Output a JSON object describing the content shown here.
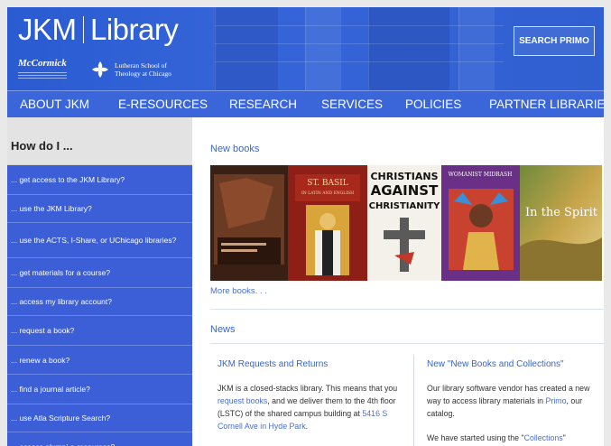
{
  "header": {
    "title_left": "JKM",
    "title_right": "Library",
    "logo_mccormick": "McCormick",
    "logo_lstc_line1": "Lutheran School of",
    "logo_lstc_line2": "Theology at Chicago",
    "search_button": "SEARCH PRIMO"
  },
  "nav": {
    "items": [
      "ABOUT JKM",
      "E-RESOURCES",
      "RESEARCH",
      "SERVICES",
      "POLICIES",
      "PARTNER LIBRARIES"
    ]
  },
  "sidebar": {
    "heading": "How do I ...",
    "items": [
      "... get access to the JKM Library?",
      "... use the JKM Library?",
      "... use the ACTS, I-Share, or UChicago libraries?",
      "... get materials for a course?",
      "... access my library account?",
      "... request a book?",
      "... renew a book?",
      "... find a journal article?",
      "... use Atla Scripture Search?",
      "... access alumni e-resources?"
    ]
  },
  "main": {
    "new_books_heading": "New books",
    "more_books": "More books. . .",
    "news_heading": "News",
    "books": [
      {
        "title_line1": "ST. BASIL",
        "subtitle": "IN LATIN AND ENGLISH",
        "accent": "#b8372a"
      },
      {
        "title_line1": "CHRISTIANS",
        "title_line2": "AGAINST",
        "title_line3": "CHRISTIANITY",
        "accent": "#c0392b"
      },
      {
        "title_line1": "WOMANIST MIDRASH",
        "accent": "#7b3fa0"
      },
      {
        "title_line1": "In the Spirit",
        "accent": "#c79a2e"
      }
    ],
    "requests": {
      "title": "JKM Requests and Returns",
      "text_1": "JKM is a closed-stacks library. This means that you ",
      "link_1": "request books",
      "text_2": ", and we deliver them to the 4th floor (LSTC) of the shared campus building at ",
      "link_2": "5416 S Cornell Ave in Hyde Park",
      "text_3": "."
    },
    "new_books_collections": {
      "title": "New \"New Books and Collections\"",
      "text_1": "Our library software vendor has created a new way to access library materials in ",
      "link_1": "Primo",
      "text_2": ", our catalog.",
      "text_3": "We have started using the \"",
      "link_2": "Collections",
      "text_4": "\""
    }
  },
  "colors": {
    "header_blue": "#2f5fd0",
    "nav_blue": "#3b66d9",
    "sidebar_item_blue": "#3c5fd8",
    "link_blue": "#4a6fd0"
  }
}
